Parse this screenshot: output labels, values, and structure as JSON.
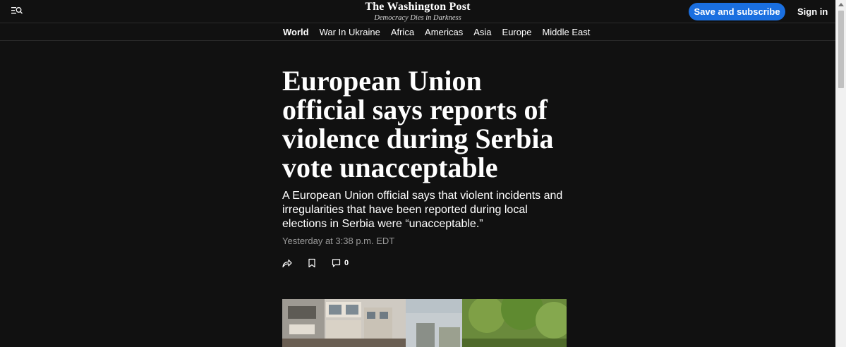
{
  "header": {
    "logo": "The Washington Post",
    "tagline": "Democracy Dies in Darkness",
    "subscribe_label": "Save and subscribe",
    "signin_label": "Sign in",
    "menu_icon": "menu-search-icon",
    "accent_color": "#1a6fe0"
  },
  "nav": {
    "items": [
      "World",
      "War In Ukraine",
      "Africa",
      "Americas",
      "Asia",
      "Europe",
      "Middle East"
    ],
    "active": "World"
  },
  "article": {
    "headline": "European Union official says reports of violence during Serbia vote unacceptable",
    "dek": "A European Union official says that violent incidents and irregularities that have been reported during local elections in Serbia were “unacceptable.”",
    "timestamp": "Yesterday at 3:38 p.m. EDT",
    "actions": {
      "share_icon": "share-icon",
      "save_icon": "bookmark-icon",
      "comment_icon": "comment-icon",
      "comment_count": "0"
    }
  }
}
